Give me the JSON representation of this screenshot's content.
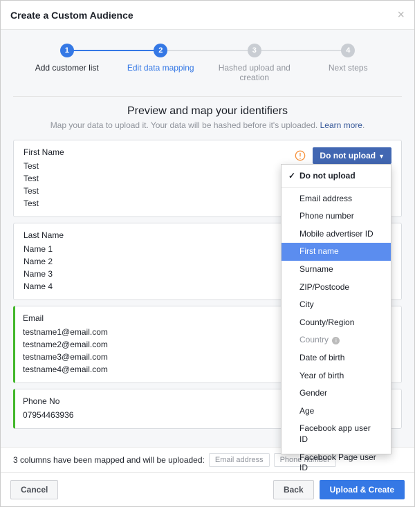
{
  "header": {
    "title": "Create a Custom Audience"
  },
  "stepper": {
    "steps": [
      {
        "num": "1",
        "label": "Add customer list",
        "state": "done"
      },
      {
        "num": "2",
        "label": "Edit data mapping",
        "state": "cur"
      },
      {
        "num": "3",
        "label": "Hashed upload and creation",
        "state": ""
      },
      {
        "num": "4",
        "label": "Next steps",
        "state": ""
      }
    ]
  },
  "preview": {
    "title": "Preview and map your identifiers",
    "desc": "Map your data to upload it. Your data will be hashed before it's uploaded. ",
    "learn": "Learn more"
  },
  "columns": [
    {
      "header": "First Name",
      "rows": [
        "Test",
        "Test",
        "Test",
        "Test"
      ],
      "status": "warn",
      "sel": "Do not upload",
      "open": true
    },
    {
      "header": "Last Name",
      "rows": [
        "Name 1",
        "Name 2",
        "Name 3",
        "Name 4"
      ],
      "status": "warn",
      "sel": "",
      "open": false
    },
    {
      "header": "Email",
      "rows": [
        "testname1@email.com",
        "testname2@email.com",
        "testname3@email.com",
        "testname4@email.com"
      ],
      "status": "ok",
      "sel": "",
      "open": false
    },
    {
      "header": "Phone No",
      "rows": [
        "07954463936"
      ],
      "status": "ok",
      "sel": "",
      "open": false
    }
  ],
  "dropdown": {
    "selected": "Do not upload",
    "highlight": "First name",
    "items": [
      "Email address",
      "Phone number",
      "Mobile advertiser ID",
      "First name",
      "Surname",
      "ZIP/Postcode",
      "City",
      "County/Region"
    ],
    "muted": "Country",
    "items2": [
      "Date of birth",
      "Year of birth",
      "Gender",
      "Age",
      "Facebook app user ID",
      "Facebook Page user ID"
    ]
  },
  "mapped": {
    "text": "3 columns have been mapped and will be uploaded:",
    "chips": [
      "Email address",
      "Phone number"
    ]
  },
  "footer": {
    "cancel": "Cancel",
    "back": "Back",
    "upload": "Upload & Create"
  }
}
